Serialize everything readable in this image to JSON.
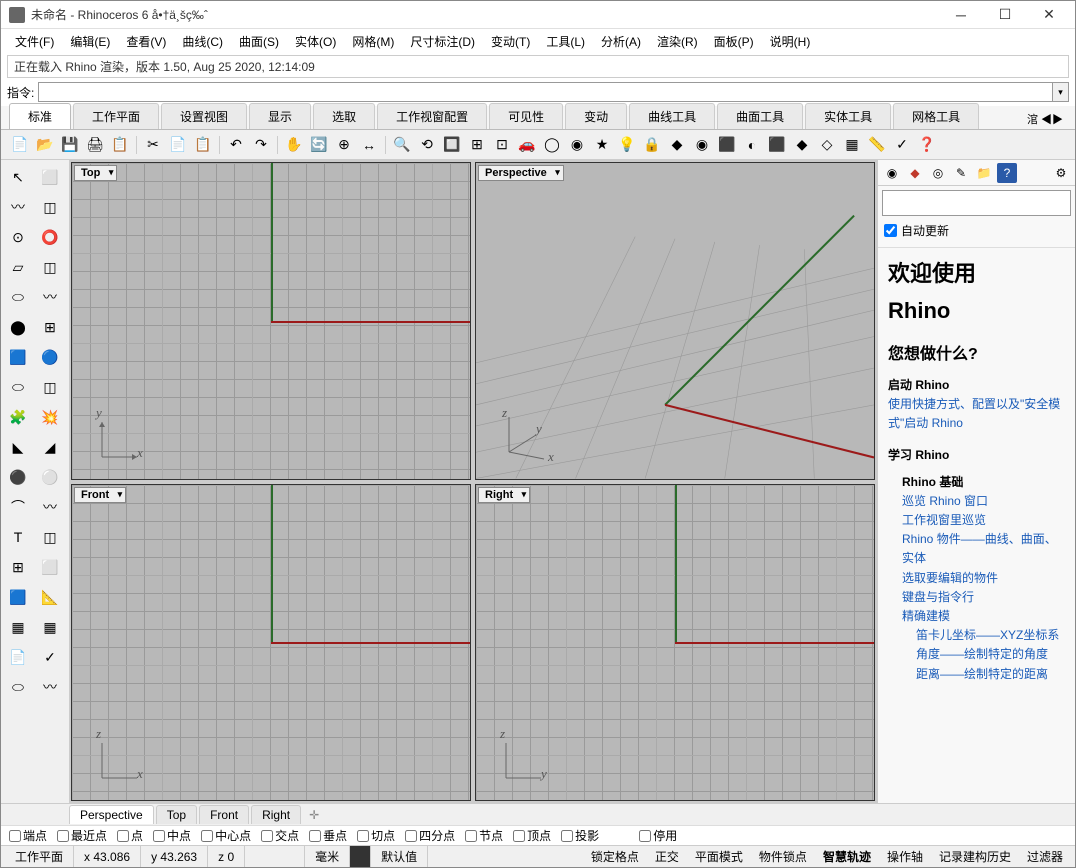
{
  "titlebar": {
    "title": "未命名 - Rhinoceros 6 å•†ä¸šç‰ˆ"
  },
  "menu": [
    "文件(F)",
    "编辑(E)",
    "查看(V)",
    "曲线(C)",
    "曲面(S)",
    "实体(O)",
    "网格(M)",
    "尺寸标注(D)",
    "变动(T)",
    "工具(L)",
    "分析(A)",
    "渲染(R)",
    "面板(P)",
    "说明(H)"
  ],
  "console_line": "正在载入 Rhino 渲染，版本 1.50, Aug 25 2020, 12:14:09",
  "command_label": "指令:",
  "tabs": [
    "标准",
    "工作平面",
    "设置视图",
    "显示",
    "选取",
    "工作视窗配置",
    "可见性",
    "变动",
    "曲线工具",
    "曲面工具",
    "实体工具",
    "网格工具"
  ],
  "tab_more": "涫 ◀▶",
  "viewports": {
    "top": "Top",
    "persp": "Perspective",
    "front": "Front",
    "right": "Right"
  },
  "bottom_tabs": [
    "Perspective",
    "Top",
    "Front",
    "Right"
  ],
  "osnap": [
    "端点",
    "最近点",
    "点",
    "中点",
    "中心点",
    "交点",
    "垂点",
    "切点",
    "四分点",
    "节点",
    "顶点",
    "投影"
  ],
  "osnap_pause": "停用",
  "right": {
    "auto_update": "自动更新",
    "welcome_h1a": "欢迎使用",
    "welcome_h1b": "Rhino",
    "what_h2": "您想做什么?",
    "start_head": "启动 Rhino",
    "start_link": "使用快捷方式、配置以及\"安全模式\"启动 Rhino",
    "learn_head": "学习 Rhino",
    "basics_head": "Rhino 基础",
    "link1": "巡览 Rhino 窗口",
    "link2": "工作视窗里巡览",
    "link3": "Rhino 物件——曲线、曲面、实体",
    "link4": "选取要编辑的物件",
    "link5": "键盘与指令行",
    "link6": "精确建模",
    "link7": "笛卡儿坐标——XYZ坐标系",
    "link8": "角度——绘制特定的角度",
    "link9": "距离——绘制特定的距离"
  },
  "status": {
    "cplane": "工作平面",
    "x": "x 43.086",
    "y": "y 43.263",
    "z": "z 0",
    "units": "毫米",
    "layer": "默认值",
    "right_items": [
      "锁定格点",
      "正交",
      "平面模式",
      "物件锁点",
      "智慧轨迹",
      "操作轴",
      "记录建构历史",
      "过滤器"
    ]
  }
}
